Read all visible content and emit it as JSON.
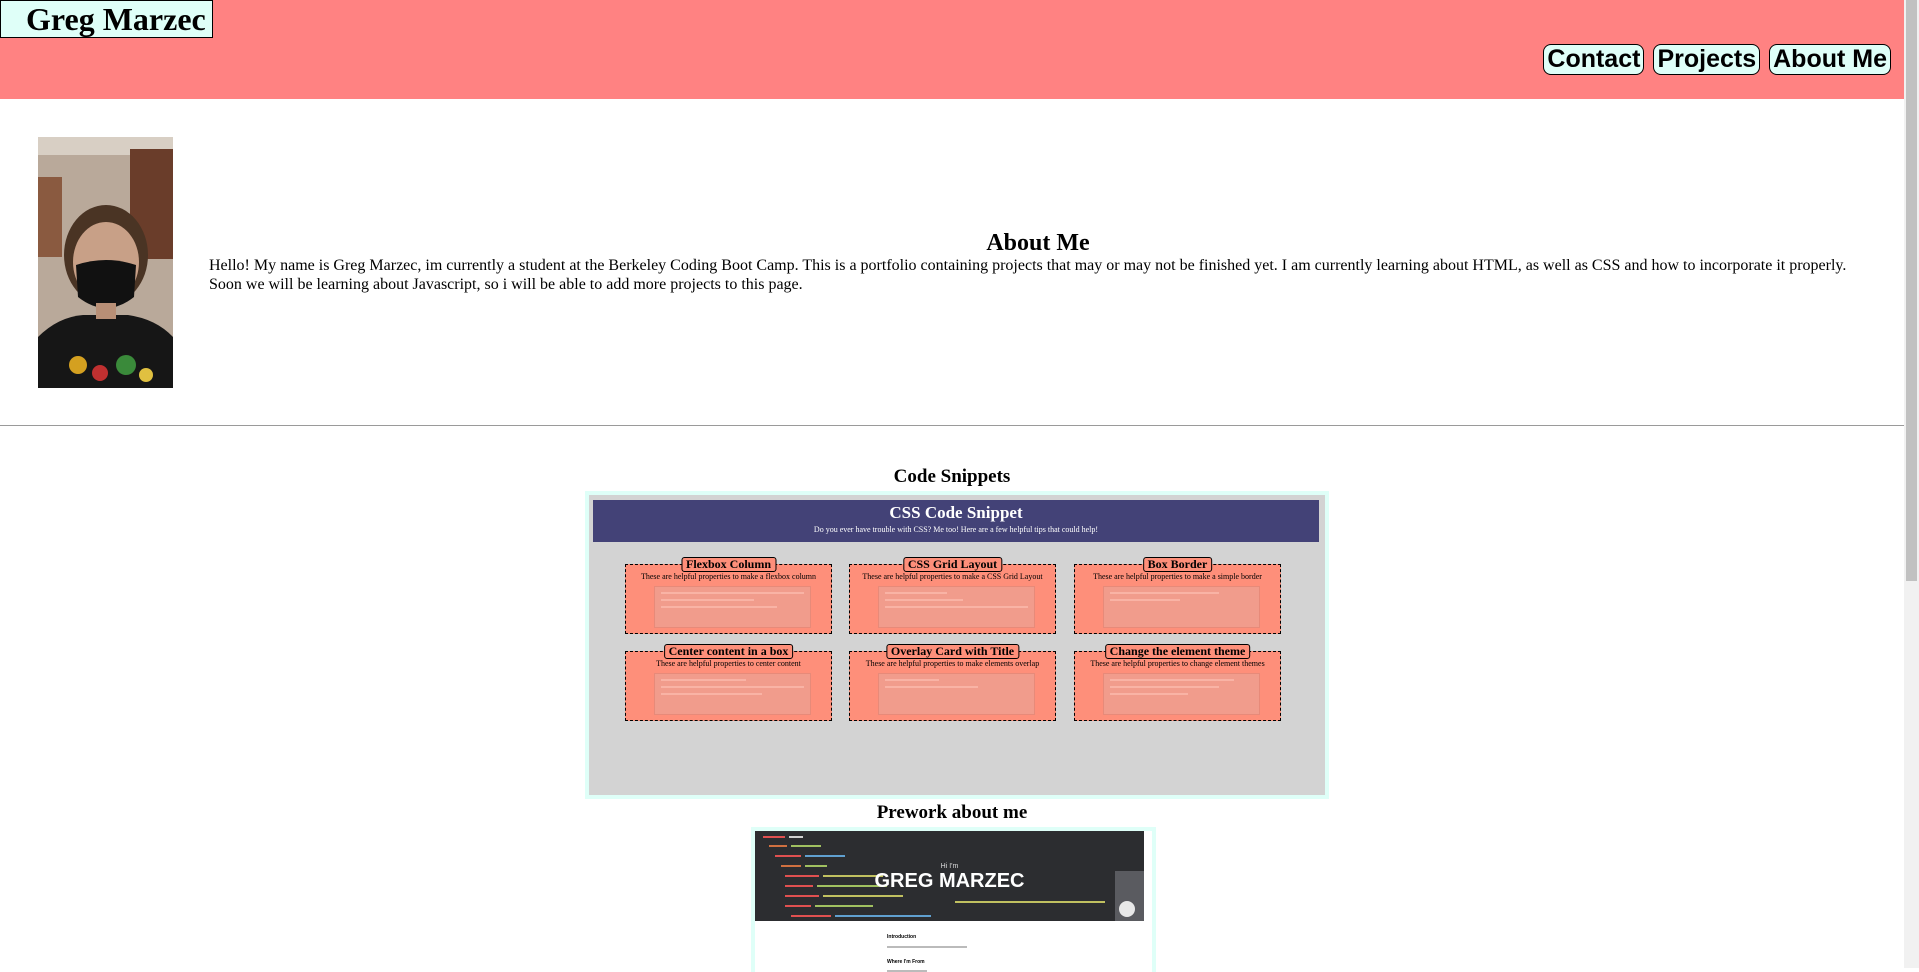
{
  "header": {
    "brand": "Greg Marzec",
    "nav": [
      "Contact",
      "Projects",
      "About Me"
    ]
  },
  "about": {
    "title": "About Me",
    "text": "Hello! My name is Greg Marzec, im currently a student at the Berkeley Coding Boot Camp. This is a portfolio containing projects that may or may not be finished yet. I am currently learning about HTML, as well as CSS and how to incorporate it properly. Soon we will be learning about Javascript, so i will be able to add more projects to this page."
  },
  "code_snippets": {
    "section_title": "Code Snippets",
    "banner_title": "CSS Code Snippet",
    "banner_subtitle": "Do you ever have trouble with CSS? Me too! Here are a few helpful tips that could help!",
    "cards": [
      {
        "title": "Flexbox Column",
        "desc": "These are helpful properties to make a flexbox column"
      },
      {
        "title": "CSS Grid Layout",
        "desc": "These are helpful properties to make a CSS Grid Layout"
      },
      {
        "title": "Box Border",
        "desc": "These are helpful properties to make a simple border"
      },
      {
        "title": "Center content in a box",
        "desc": "These are helpful properties to center content"
      },
      {
        "title": "Overlay Card with Title",
        "desc": "These are helpful properties to make elements overlap"
      },
      {
        "title": "Change the element theme",
        "desc": "These are helpful properties to change element themes"
      }
    ]
  },
  "prework": {
    "section_title": "Prework about me",
    "hi": "Hi I'm",
    "name": "GREG MARZEC",
    "intro": "Introduction",
    "where": "Where I'm From"
  },
  "colors": {
    "header_bg": "#ff8282",
    "button_bg": "#dffff8",
    "banner_bg": "#434277",
    "card_bg": "#fe8f7a",
    "panel_bg": "#d3d3d3"
  }
}
